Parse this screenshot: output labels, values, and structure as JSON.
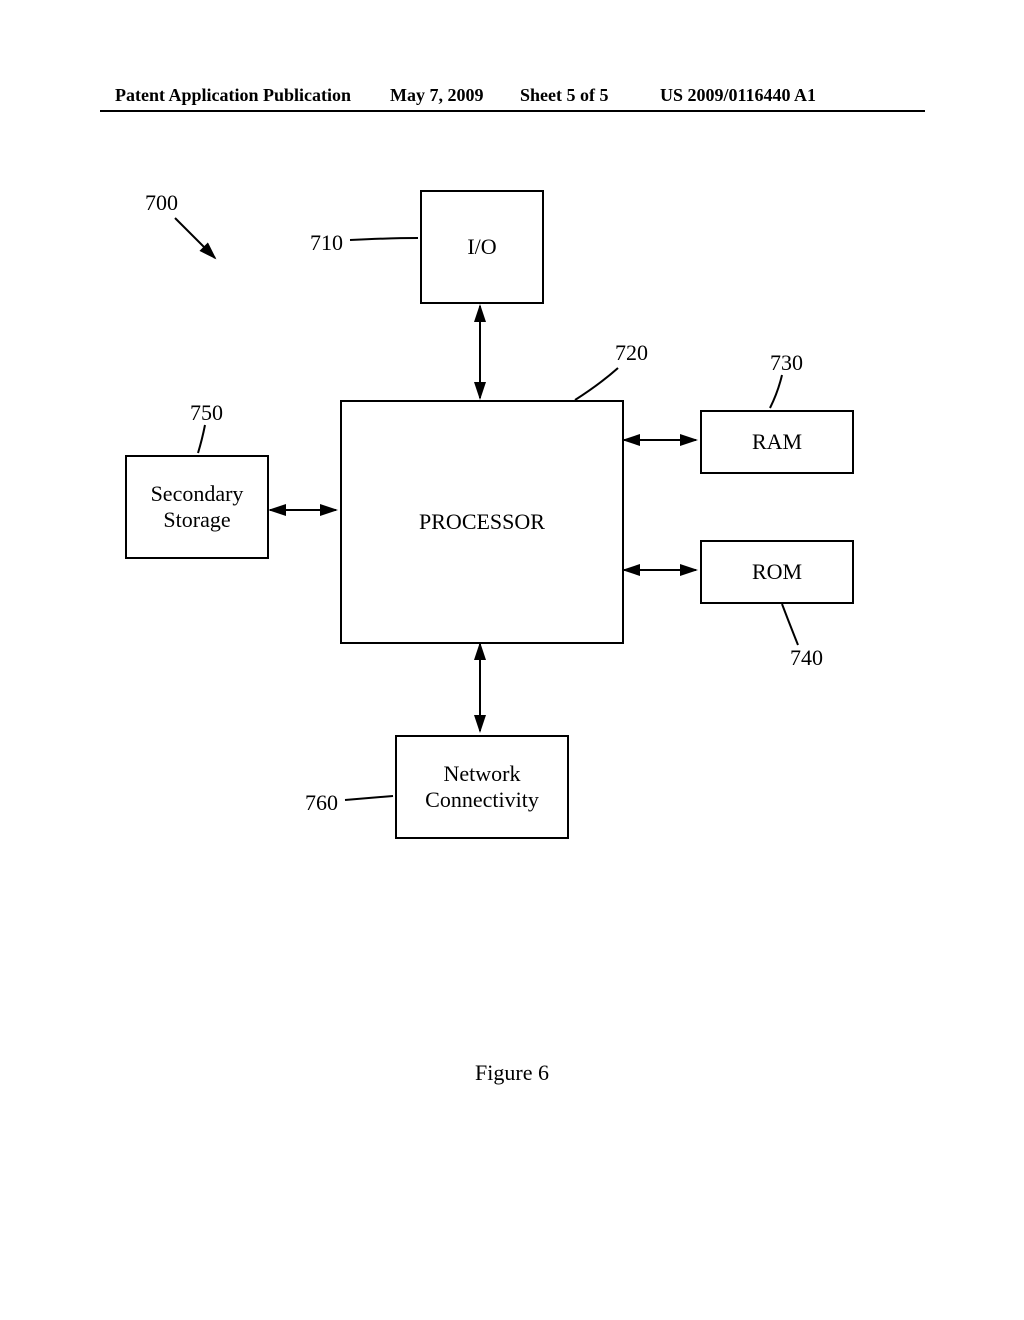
{
  "header": {
    "left": "Patent Application Publication",
    "date": "May 7, 2009",
    "sheet": "Sheet 5 of 5",
    "pubnum": "US 2009/0116440 A1"
  },
  "labels": {
    "fig_ref": "700",
    "io_ref": "710",
    "proc_ref": "720",
    "ram_ref": "730",
    "rom_ref": "740",
    "storage_ref": "750",
    "net_ref": "760"
  },
  "blocks": {
    "io": "I/O",
    "processor": "PROCESSOR",
    "ram": "RAM",
    "rom": "ROM",
    "storage": "Secondary\nStorage",
    "network": "Network\nConnectivity"
  },
  "figure_caption": "Figure 6"
}
